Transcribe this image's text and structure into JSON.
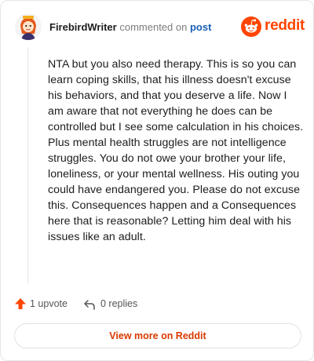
{
  "header": {
    "author": "FirebirdWriter",
    "action": "commented on",
    "link_text": "post",
    "brand": "reddit"
  },
  "comment": {
    "body": "NTA but you also need therapy. This is so you can learn coping skills, that his illness doesn't excuse his behaviors, and that you deserve a life. Now I am aware that not everything he does can be controlled but I see some calculation in his choices. Plus mental health struggles are not intelligence struggles. You do not owe your brother your life, loneliness, or your mental wellness. His outing you could have endangered you. Please do not excuse this. Consequences happen and a Consequences here that is reasonable? Letting him deal with his issues like an adult."
  },
  "actions": {
    "upvotes": "1 upvote",
    "replies": "0 replies"
  },
  "footer": {
    "view_more": "View more on Reddit"
  },
  "colors": {
    "brand": "#ff4500",
    "link": "#1a5fb4",
    "cta": "#d93900"
  },
  "icons": {
    "avatar": "avatar-icon",
    "logo": "reddit-logo-icon",
    "upvote": "upvote-arrow-icon",
    "reply": "reply-arrow-icon"
  }
}
